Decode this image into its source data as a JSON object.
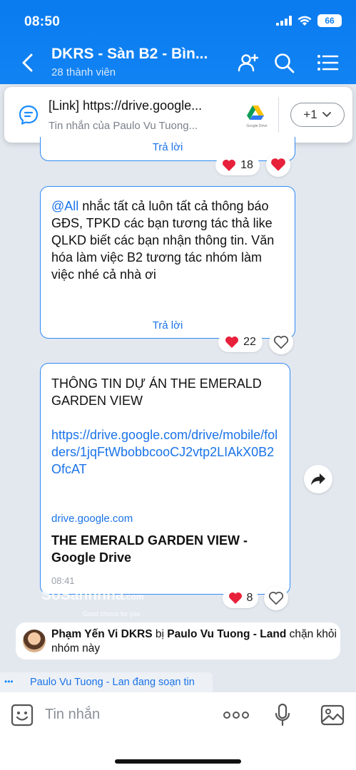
{
  "status": {
    "time": "08:50",
    "battery": "66"
  },
  "header": {
    "title": "DKRS - Sàn B2 - Bìn...",
    "members": "28 thành viên"
  },
  "pinned": {
    "title": "[Link] https://drive.google...",
    "subtitle": "Tin nhắn của Paulo Vu Tuong...",
    "drive_label": "Google Drive",
    "more_count": "+1"
  },
  "messages": [
    {
      "reply_label": "Trả lời",
      "reactions": "18"
    },
    {
      "mention": "@All",
      "text": " nhắc tất cả luôn tất cả thông báo GĐS, TPKD các bạn tương tác thả like QLKD biết các bạn nhận thông tin. Văn hóa làm việc B2 tương tác nhóm làm việc nhé cả nhà ơi",
      "reply_label": "Trả lời",
      "reactions": "22"
    },
    {
      "title": "THÔNG TIN DỰ ÁN THE EMERALD GARDEN VIEW",
      "link": "https://drive.google.com/drive/mobile/folders/1jqFtWbobbcooCJ2vtp2LIAkX0B2OfcAT",
      "domain": "drive.google.com",
      "preview_title": "THE EMERALD GARDEN VIEW - Google Drive",
      "time": "08:41",
      "reactions": "8"
    }
  ],
  "notice": {
    "actor": "Phạm Yến Vi DKRS",
    "verb": " bị ",
    "by": "Paulo Vu Tuong - Land",
    "action": " chặn khỏi nhóm này"
  },
  "typing": {
    "text": "Paulo Vu Tuong - Lan đang soạn tin"
  },
  "input": {
    "placeholder": "Tin nhắn"
  },
  "watermark": {
    "brand": "SoSanhnha",
    "domain": ".com",
    "tagline": "Good choice for you"
  },
  "colors": {
    "header": "#1183f2",
    "accent": "#1a73e8",
    "heart": "#e8213b"
  }
}
